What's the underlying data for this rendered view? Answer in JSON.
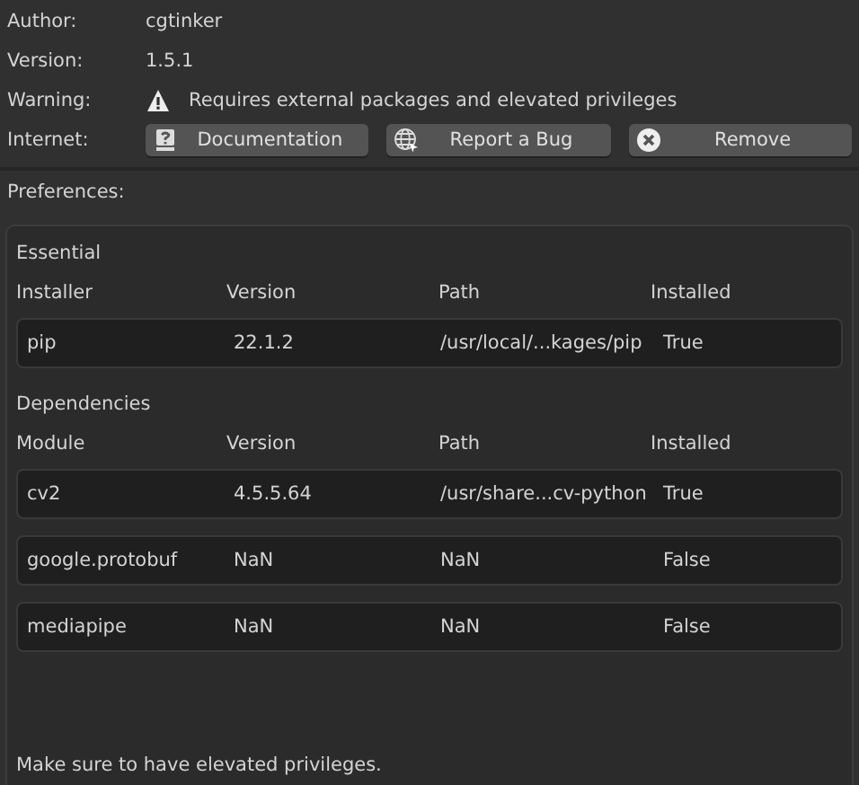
{
  "info": [
    {
      "label": "Author:",
      "value": "cgtinker"
    },
    {
      "label": "Version:",
      "value": "1.5.1"
    },
    {
      "label": "Warning:",
      "value": "Requires external packages and elevated privileges",
      "kind": "warning"
    }
  ],
  "internet": {
    "label": "Internet:",
    "buttons": [
      {
        "label": "Documentation",
        "kind": "help"
      },
      {
        "label": "Report a Bug",
        "kind": "globe"
      },
      {
        "label": "Remove",
        "kind": "remove"
      }
    ]
  },
  "preferences": {
    "label": "Preferences:",
    "sections": [
      {
        "title": "Essential",
        "columns": [
          "Installer",
          "Version",
          "Path",
          "Installed"
        ],
        "rows": [
          [
            "pip",
            "22.1.2",
            "/usr/local/...kages/pip",
            "True"
          ]
        ]
      },
      {
        "title": "Dependencies",
        "columns": [
          "Module",
          "Version",
          "Path",
          "Installed"
        ],
        "rows": [
          [
            "cv2",
            "4.5.5.64",
            "/usr/share...cv-python",
            "True"
          ],
          [
            "google.protobuf",
            "NaN",
            "NaN",
            "False"
          ],
          [
            "mediapipe",
            "NaN",
            "NaN",
            "False"
          ]
        ]
      }
    ],
    "note": "Make sure to have elevated privileges."
  }
}
